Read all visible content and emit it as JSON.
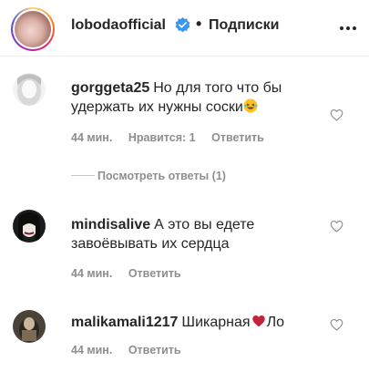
{
  "header": {
    "username": "lobodaofficial",
    "separator": "•",
    "follow_label": "Подписки"
  },
  "comments": [
    {
      "user": "gorggeta25",
      "text": "Но для того что бы удержать их нужны соски",
      "trailing_emoji": "laughing-face",
      "time": "44 мин.",
      "likes": "Нравится: 1",
      "reply": "Ответить"
    },
    {
      "user": "mindisalive",
      "text": "А это вы едете завоёвывать их сердца",
      "time": "44 мин.",
      "reply": "Ответить"
    },
    {
      "user": "malikamali1217",
      "text_before": "Шикарная",
      "text_after": "Ло",
      "time": "44 мин.",
      "reply": "Ответить"
    }
  ],
  "view_replies": "Посмотреть ответы (1)",
  "colors": {
    "text": "#262626",
    "muted": "#8e8e8e",
    "verified": "#3897f0",
    "heart_red": "#c4233f"
  }
}
